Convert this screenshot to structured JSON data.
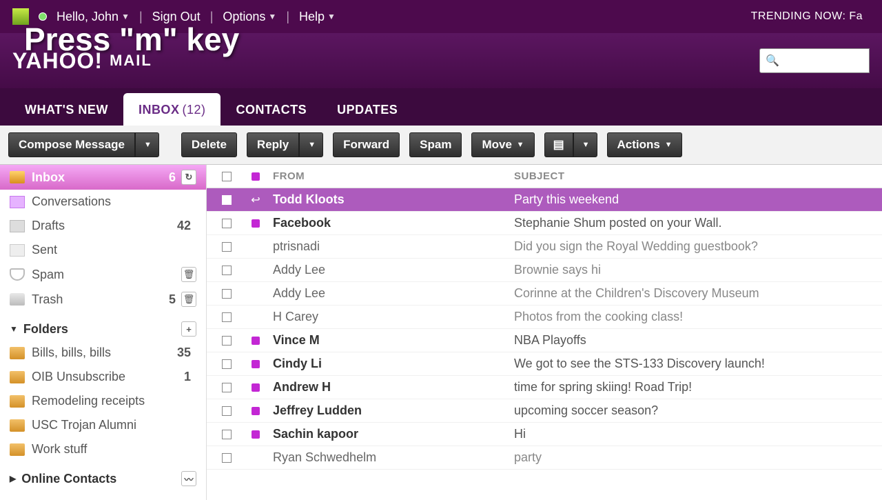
{
  "overlay_hint": "Press \"m\" key",
  "topbar": {
    "greeting": "Hello, John",
    "signout": "Sign Out",
    "options": "Options",
    "help": "Help",
    "trending_label": "TRENDING NOW: Fa"
  },
  "brand": {
    "name": "YAHOO!",
    "sub": "MAIL"
  },
  "search": {
    "placeholder": ""
  },
  "tabs": [
    {
      "label": "WHAT'S NEW",
      "active": false
    },
    {
      "label": "INBOX",
      "count": "(12)",
      "active": true
    },
    {
      "label": "CONTACTS",
      "active": false
    },
    {
      "label": "UPDATES",
      "active": false
    }
  ],
  "toolbar": {
    "compose": "Compose Message",
    "delete": "Delete",
    "reply": "Reply",
    "forward": "Forward",
    "spam": "Spam",
    "move": "Move",
    "actions": "Actions"
  },
  "sidebar": {
    "system": [
      {
        "icon": "inbox",
        "label": "Inbox",
        "count": "6",
        "action": "refresh",
        "selected": true
      },
      {
        "icon": "conv",
        "label": "Conversations"
      },
      {
        "icon": "drafts",
        "label": "Drafts",
        "count": "42"
      },
      {
        "icon": "sent",
        "label": "Sent"
      },
      {
        "icon": "spam",
        "label": "Spam",
        "action": "trash"
      },
      {
        "icon": "trash",
        "label": "Trash",
        "count": "5",
        "action": "trash"
      }
    ],
    "folders_header": "Folders",
    "folders": [
      {
        "label": "Bills, bills, bills",
        "count": "35"
      },
      {
        "label": "OIB Unsubscribe",
        "count": "1"
      },
      {
        "label": "Remodeling receipts"
      },
      {
        "label": "USC Trojan Alumni"
      },
      {
        "label": "Work stuff"
      }
    ],
    "contacts_header": "Online Contacts"
  },
  "grid": {
    "headers": {
      "from": "FROM",
      "subject": "SUBJECT"
    },
    "rows": [
      {
        "from": "Todd Kloots",
        "subject": "Party this weekend",
        "unread": true,
        "selected": true,
        "replied": true
      },
      {
        "from": "Facebook",
        "subject": "Stephanie Shum posted on your Wall.",
        "unread": true
      },
      {
        "from": "ptrisnadi",
        "subject": "Did you sign the Royal Wedding guestbook?",
        "unread": false
      },
      {
        "from": "Addy Lee",
        "subject": "Brownie says hi",
        "unread": false
      },
      {
        "from": "Addy Lee",
        "subject": "Corinne at the Children's Discovery Museum",
        "unread": false
      },
      {
        "from": "H Carey",
        "subject": "Photos from the cooking class!",
        "unread": false
      },
      {
        "from": "Vince M",
        "subject": "NBA Playoffs",
        "unread": true
      },
      {
        "from": "Cindy Li",
        "subject": "We got to see the STS-133 Discovery launch!",
        "unread": true
      },
      {
        "from": "Andrew H",
        "subject": "time for spring skiing! Road Trip!",
        "unread": true
      },
      {
        "from": "Jeffrey Ludden",
        "subject": "upcoming soccer season?",
        "unread": true
      },
      {
        "from": "Sachin kapoor",
        "subject": "Hi",
        "unread": true
      },
      {
        "from": "Ryan Schwedhelm",
        "subject": "party",
        "unread": false
      }
    ]
  }
}
